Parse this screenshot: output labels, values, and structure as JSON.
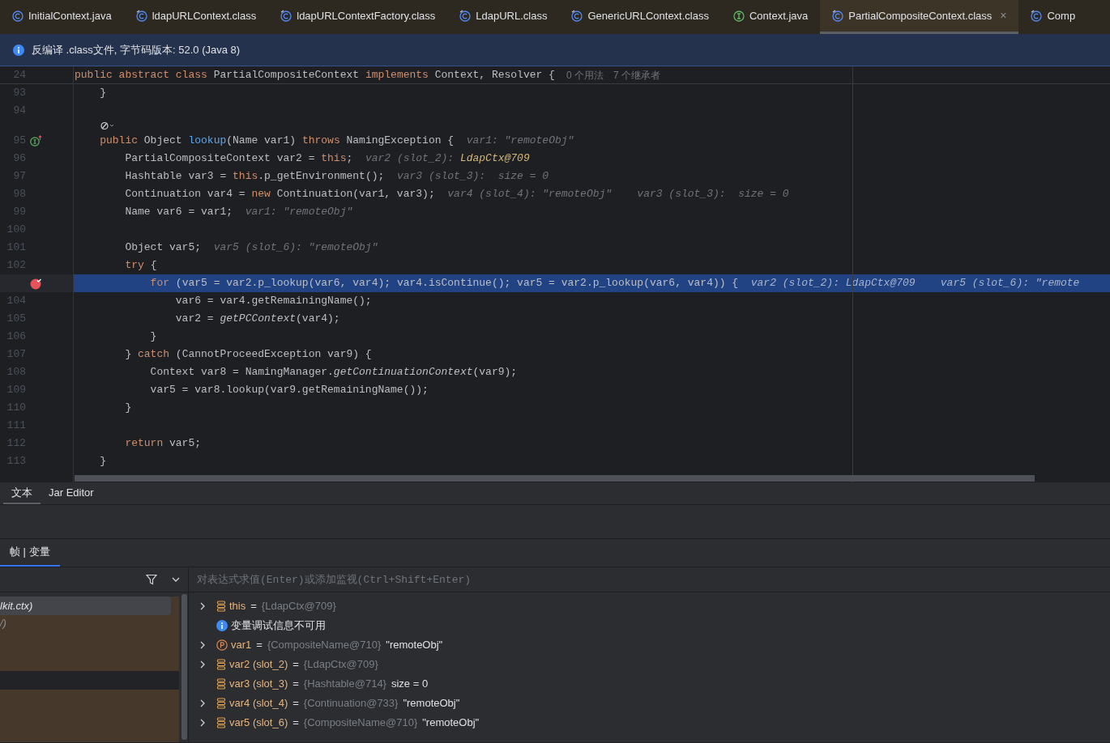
{
  "tabs": [
    {
      "label": "InitialContext.java",
      "kind": "class",
      "selected": false
    },
    {
      "label": "ldapURLContext.class",
      "kind": "compiled",
      "selected": false
    },
    {
      "label": "ldapURLContextFactory.class",
      "kind": "compiled",
      "selected": false
    },
    {
      "label": "LdapURL.class",
      "kind": "compiled",
      "selected": false
    },
    {
      "label": "GenericURLContext.class",
      "kind": "compiled",
      "selected": false
    },
    {
      "label": "Context.java",
      "kind": "interface",
      "selected": false
    },
    {
      "label": "PartialCompositeContext.class",
      "kind": "compiled",
      "selected": true,
      "close": "×"
    },
    {
      "label": "Comp",
      "kind": "compiled",
      "selected": false
    }
  ],
  "banner": {
    "text": "反编译 .class文件, 字节码版本: 52.0 (Java 8)"
  },
  "sticky_line": {
    "number": "24",
    "segments": [
      {
        "text": "public abstract class",
        "kind": "keyword"
      },
      {
        "text": " PartialCompositeContext ",
        "kind": "plain"
      },
      {
        "text": "implements",
        "kind": "keyword"
      },
      {
        "text": " Context, Resolver {",
        "kind": "plain"
      }
    ],
    "usages": "0 个用法",
    "inheritors": "7 个继承者"
  },
  "code_lines": [
    {
      "kind": "code",
      "number": "93",
      "segments": [
        {
          "text": "    }",
          "kind": "plain"
        }
      ]
    },
    {
      "kind": "code",
      "number": "94"
    },
    {
      "kind": "inlay"
    },
    {
      "kind": "code",
      "number": "95",
      "implementation_marker": true,
      "segments": [
        {
          "text": "    public",
          "kind": "keyword"
        },
        {
          "text": " Object ",
          "kind": "plain"
        },
        {
          "text": "lookup",
          "kind": "method"
        },
        {
          "text": "(Name var1) ",
          "kind": "plain"
        },
        {
          "text": "throws",
          "kind": "keyword"
        },
        {
          "text": " NamingException {",
          "kind": "plain"
        },
        {
          "text": "  var1: \"remoteObj\"",
          "kind": "hint"
        }
      ]
    },
    {
      "kind": "code",
      "number": "96",
      "segments": [
        {
          "text": "        PartialCompositeContext var2 = ",
          "kind": "plain"
        },
        {
          "text": "this",
          "kind": "keyword"
        },
        {
          "text": ";",
          "kind": "plain"
        },
        {
          "text": "  var2 (slot_2): ",
          "kind": "hint"
        },
        {
          "text": "LdapCtx@709",
          "kind": "hint_ref"
        }
      ]
    },
    {
      "kind": "code",
      "number": "97",
      "segments": [
        {
          "text": "        Hashtable var3 = ",
          "kind": "plain"
        },
        {
          "text": "this",
          "kind": "keyword"
        },
        {
          "text": ".p_getEnvironment();",
          "kind": "plain"
        },
        {
          "text": "  var3 (slot_3):  size = 0",
          "kind": "hint"
        }
      ]
    },
    {
      "kind": "code",
      "number": "98",
      "segments": [
        {
          "text": "        Continuation var4 = ",
          "kind": "plain"
        },
        {
          "text": "new",
          "kind": "keyword"
        },
        {
          "text": " Continuation(var1, var3);",
          "kind": "plain"
        },
        {
          "text": "  var4 (slot_4): \"remoteObj\"    var3 (slot_3):  size = 0",
          "kind": "hint"
        }
      ]
    },
    {
      "kind": "code",
      "number": "99",
      "segments": [
        {
          "text": "        Name var6 = var1;",
          "kind": "plain"
        },
        {
          "text": "  var1: \"remoteObj\"",
          "kind": "hint"
        }
      ]
    },
    {
      "kind": "code",
      "number": "100"
    },
    {
      "kind": "code",
      "number": "101",
      "segments": [
        {
          "text": "        Object var5;",
          "kind": "plain"
        },
        {
          "text": "  var5 (slot_6): \"remoteObj\"",
          "kind": "hint"
        }
      ]
    },
    {
      "kind": "code",
      "number": "102",
      "segments": [
        {
          "text": "        try",
          "kind": "keyword"
        },
        {
          "text": " {",
          "kind": "plain"
        }
      ]
    },
    {
      "kind": "code",
      "current": true,
      "breakpoint": true,
      "segments": [
        {
          "text": "            for",
          "kind": "keyword"
        },
        {
          "text": " (var5 = var2.p_lookup(var6, var4); var4.isContinue(); var5 = var2.p_lookup(var6, var4)) {",
          "kind": "plain"
        },
        {
          "text": "  var2 (slot_2): LdapCtx@709    var5 (slot_6): \"remote",
          "kind": "hint"
        }
      ]
    },
    {
      "kind": "code",
      "number": "104",
      "segments": [
        {
          "text": "                var6 = var4.getRemainingName();",
          "kind": "plain"
        }
      ]
    },
    {
      "kind": "code",
      "number": "105",
      "segments": [
        {
          "text": "                var2 = ",
          "kind": "plain"
        },
        {
          "text": "getPCContext",
          "kind": "static"
        },
        {
          "text": "(var4);",
          "kind": "plain"
        }
      ]
    },
    {
      "kind": "code",
      "number": "106",
      "segments": [
        {
          "text": "            }",
          "kind": "plain"
        }
      ]
    },
    {
      "kind": "code",
      "number": "107",
      "segments": [
        {
          "text": "        } ",
          "kind": "plain"
        },
        {
          "text": "catch",
          "kind": "keyword"
        },
        {
          "text": " (CannotProceedException var9) {",
          "kind": "plain"
        }
      ]
    },
    {
      "kind": "code",
      "number": "108",
      "segments": [
        {
          "text": "            Context var8 = NamingManager.",
          "kind": "plain"
        },
        {
          "text": "getContinuationContext",
          "kind": "static"
        },
        {
          "text": "(var9);",
          "kind": "plain"
        }
      ]
    },
    {
      "kind": "code",
      "number": "109",
      "segments": [
        {
          "text": "            var5 = var8.lookup(var9.getRemainingName());",
          "kind": "plain"
        }
      ]
    },
    {
      "kind": "code",
      "number": "110",
      "segments": [
        {
          "text": "        }",
          "kind": "plain"
        }
      ]
    },
    {
      "kind": "code",
      "number": "111"
    },
    {
      "kind": "code",
      "number": "112",
      "segments": [
        {
          "text": "        return",
          "kind": "keyword"
        },
        {
          "text": " var5;",
          "kind": "plain"
        }
      ]
    },
    {
      "kind": "code",
      "number": "113",
      "segments": [
        {
          "text": "    }",
          "kind": "plain"
        }
      ]
    }
  ],
  "editor_tabs": [
    {
      "label": "文本",
      "selected": true
    },
    {
      "label": "Jar Editor",
      "selected": false
    }
  ],
  "debugger": {
    "tab": "帧 | 变量",
    "frames": [
      {
        "text": "lkit.ctx)",
        "selected": true,
        "library": true
      },
      {
        "text": "/)",
        "selected": false,
        "library": true
      },
      {
        "selected": false,
        "library": true
      },
      {
        "selected": false,
        "library": true
      },
      {
        "selected": false,
        "library": false
      },
      {
        "selected": false,
        "library": true
      },
      {
        "selected": false,
        "library": true
      },
      {
        "selected": false,
        "library": true
      }
    ],
    "evaluate_placeholder": "对表达式求值(Enter)或添加监视(Ctrl+Shift+Enter)",
    "variables": [
      {
        "kind": "field",
        "expandable": true,
        "name": "this",
        "sign": "=",
        "ref": "{LdapCtx@709}"
      },
      {
        "kind": "info",
        "text": "变量调试信息不可用"
      },
      {
        "kind": "param",
        "expandable": true,
        "name": "var1",
        "sign": "=",
        "ref": "{CompositeName@710}",
        "value": "\"remoteObj\""
      },
      {
        "kind": "field",
        "expandable": true,
        "name": "var2 (slot_2)",
        "sign": "=",
        "ref": "{LdapCtx@709}"
      },
      {
        "kind": "field",
        "expandable": false,
        "name": "var3 (slot_3)",
        "sign": "=",
        "ref": "{Hashtable@714}",
        "value": "size = 0"
      },
      {
        "kind": "field",
        "expandable": true,
        "name": "var4 (slot_4)",
        "sign": "=",
        "ref": "{Continuation@733}",
        "value": "\"remoteObj\""
      },
      {
        "kind": "field",
        "expandable": true,
        "name": "var5 (slot_6)",
        "sign": "=",
        "ref": "{CompositeName@710}",
        "value": "\"remoteObj\""
      }
    ]
  }
}
